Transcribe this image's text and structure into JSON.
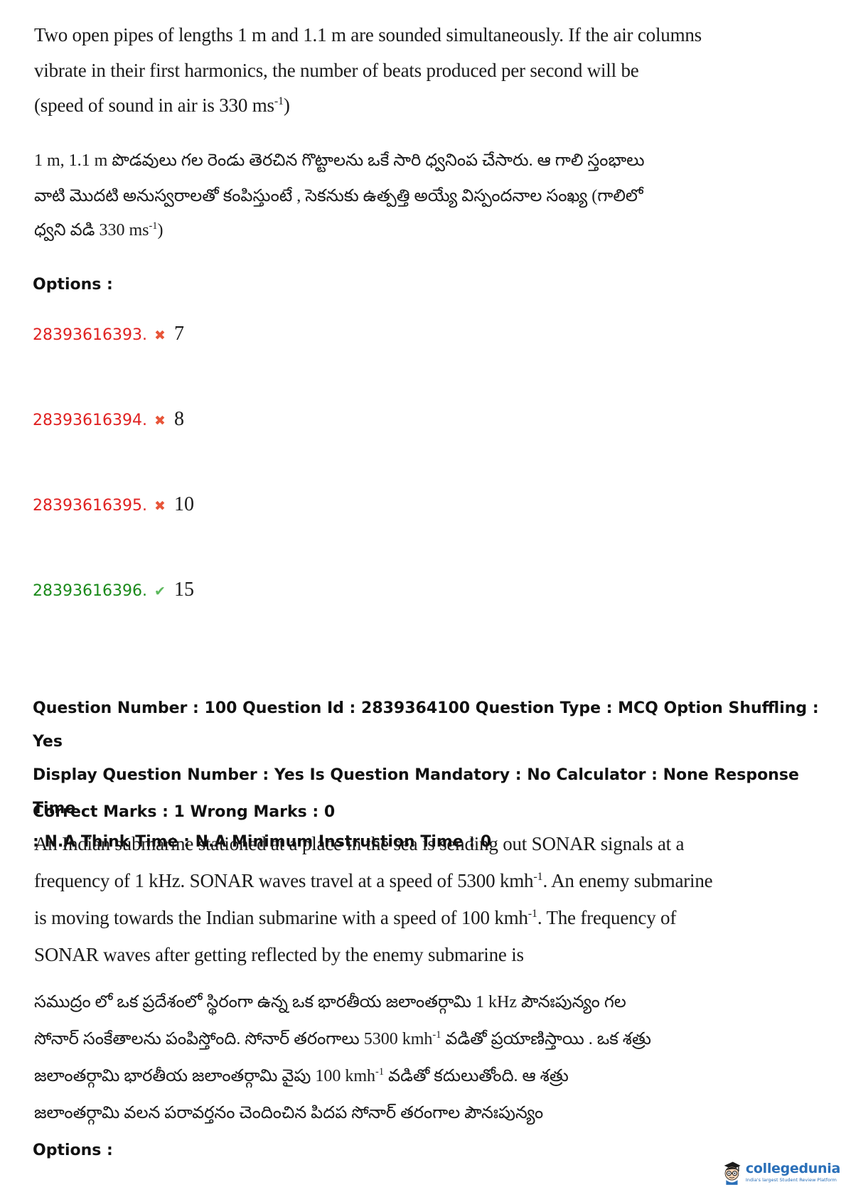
{
  "question1": {
    "english_lines": [
      "Two open pipes of lengths 1 m and 1.1 m are sounded simultaneously. If the air columns",
      "vibrate in their first harmonics, the number of beats produced per second will be",
      "(speed of sound in air is 330 ms"
    ],
    "english_sup": "-1",
    "english_close": ")",
    "telugu_lines": [
      "1 m, 1.1 m పొడవులు గల రెండు తెరచిన గొట్టాలను ఒకే సారి ధ్వనింప చేసారు. ఆ గాలి స్తంభాలు",
      "వాటి మొదటి అనుస్వరాలతో కంపిస్తుంటే , సెకనుకు ఉత్పత్తి అయ్యే విస్పందనాల సంఖ్య (గాలిలో",
      "ధ్వని వడి 330 ms"
    ],
    "telugu_sup": "-1",
    "telugu_close": ")",
    "options_label": "Options :",
    "options": [
      {
        "id": "28393616393.",
        "value": "7",
        "status": "wrong",
        "color": "#e02020",
        "icon": "cross-icon"
      },
      {
        "id": "28393616394.",
        "value": "8",
        "status": "wrong",
        "color": "#e02020",
        "icon": "cross-icon"
      },
      {
        "id": "28393616395.",
        "value": "10",
        "status": "wrong",
        "color": "#e02020",
        "icon": "cross-icon"
      },
      {
        "id": "28393616396.",
        "value": "15",
        "status": "correct",
        "color": "#1a8a1a",
        "icon": "check-icon"
      }
    ]
  },
  "question2": {
    "meta_lines": [
      "Question Number : 100 Question Id : 2839364100 Question Type : MCQ Option Shuffling : Yes",
      "Display Question Number : Yes Is Question Mandatory : No Calculator : None Response Time",
      ": N.A Think Time : N.A Minimum Instruction Time : 0"
    ],
    "marks": "Correct Marks : 1 Wrong Marks : 0",
    "english": {
      "l1": "An Indian submarine stationed at a place in the sea is sending out SONAR signals at a",
      "l2a": "frequency of 1 kHz. SONAR waves travel at a speed of 5300 kmh",
      "l2sup": "-1",
      "l2b": ". An enemy submarine",
      "l3a": "is moving towards the Indian submarine with a speed of 100 kmh",
      "l3sup": "-1",
      "l3b": ". The frequency of",
      "l4": "SONAR waves after getting reflected by the enemy submarine is"
    },
    "telugu": {
      "l1": "సముద్రం లో ఒక ప్రదేశంలో స్థిరంగా ఉన్న ఒక  భారతీయ జలాంతర్గామి 1 kHz పౌనఃపున్యం గల",
      "l2a": "సోనార్ సంకేతాలను పంపిస్తోంది. సోనార్ తరంగాలు 5300 kmh",
      "l2sup": "-1",
      "l2b": " వడితో ప్రయాణిస్తాయి . ఒక శత్రు",
      "l3a": "జలాంతర్గామి భారతీయ జలాంతర్గామి వైపు 100 kmh",
      "l3sup": "-1",
      "l3b": " వడితో కదులుతోంది. ఆ శత్రు",
      "l4": "జలాంతర్గామి వలన పరావర్తనం చెందించిన పిదప సోనార్ తరంగాల పౌనఃపున్యం"
    },
    "options_label": "Options :"
  },
  "logo": {
    "name": "collegedunia",
    "tagline": "India's largest Student Review Platform",
    "brand_color": "#2a6fb8"
  }
}
